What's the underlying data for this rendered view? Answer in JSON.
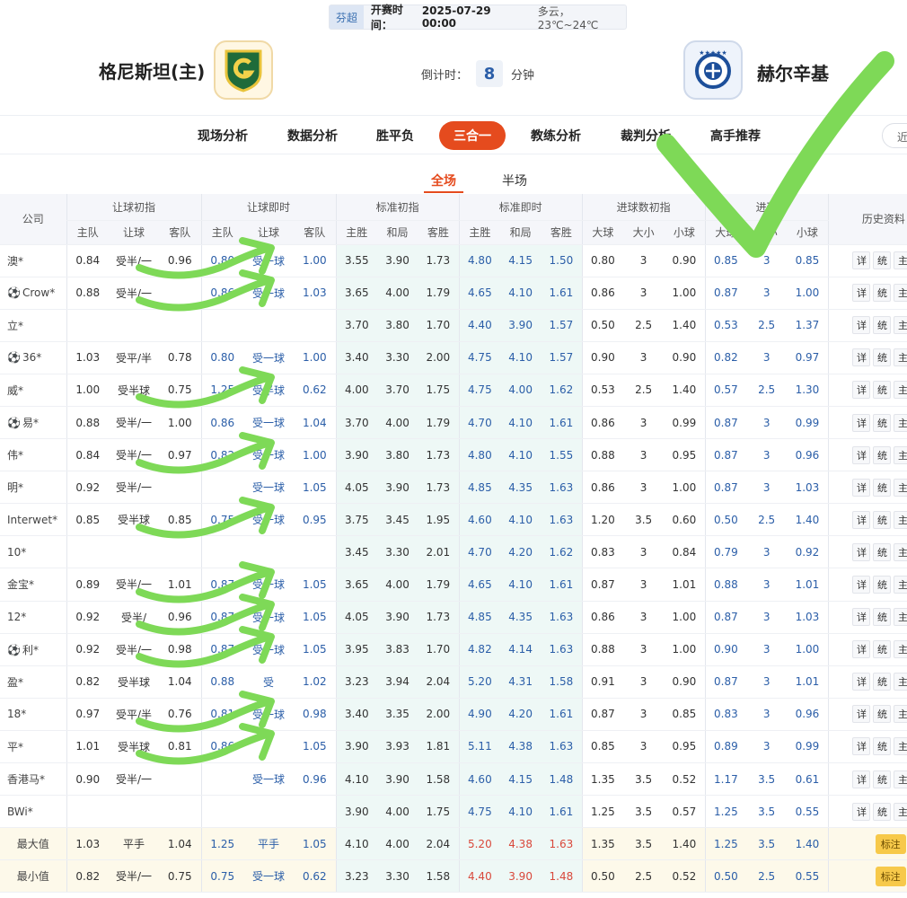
{
  "header": {
    "league": "芬超",
    "kickoff_label": "开赛时间：",
    "kickoff_time": "2025-07-29 00:00",
    "weather": "多云，23℃~24℃",
    "home_team": "格尼斯坦(主)",
    "away_team": "赫尔辛基",
    "countdown_label": "倒计时：",
    "countdown_value": "8",
    "countdown_unit": "分钟",
    "home_logo_icon": "gnistan-shield-logo-icon",
    "away_logo_icon": "hjk-crest-logo-icon"
  },
  "nav": {
    "tabs": [
      "现场分析",
      "数据分析",
      "胜平负",
      "三合一",
      "教练分析",
      "裁判分析",
      "高手推荐"
    ],
    "active_tab": "三合一",
    "recent": "近"
  },
  "scope": {
    "tabs": [
      "全场",
      "半场"
    ],
    "active": "全场"
  },
  "table": {
    "company_header": "公司",
    "groups": [
      "让球初指",
      "让球即时",
      "标准初指",
      "标准即时",
      "进球数初指",
      "进球数即时",
      "历史资料"
    ],
    "group_6_visible": "进球",
    "subheaders": {
      "handicap": [
        "主队",
        "让球",
        "客队"
      ],
      "standard": [
        "主胜",
        "和局",
        "客胜"
      ],
      "totals": [
        "大球",
        "大小",
        "小球"
      ]
    },
    "actions": [
      "详",
      "统",
      "主"
    ],
    "rows": [
      {
        "company": "澳*",
        "icon": "",
        "hi": [
          "0.84",
          "受半/一",
          "0.96"
        ],
        "hn": [
          "0.80",
          "受一球",
          "1.00"
        ],
        "si": [
          "3.55",
          "3.90",
          "1.73"
        ],
        "sn": [
          "4.80",
          "4.15",
          "1.50"
        ],
        "ti": [
          "0.80",
          "3",
          "0.90"
        ],
        "tn": [
          "0.85",
          "3",
          "0.85"
        ]
      },
      {
        "company": "Crow*",
        "icon": "soccer-ball-icon",
        "hi": [
          "0.88",
          "受半/一",
          ""
        ],
        "hn": [
          "0.86",
          "受一球",
          "1.03"
        ],
        "si": [
          "3.65",
          "4.00",
          "1.79"
        ],
        "sn": [
          "4.65",
          "4.10",
          "1.61"
        ],
        "ti": [
          "0.86",
          "3",
          "1.00"
        ],
        "tn": [
          "0.87",
          "3",
          "1.00"
        ]
      },
      {
        "company": "立*",
        "icon": "",
        "hi": [
          "",
          "",
          ""
        ],
        "hn": [
          "",
          "",
          ""
        ],
        "si": [
          "3.70",
          "3.80",
          "1.70"
        ],
        "sn": [
          "4.40",
          "3.90",
          "1.57"
        ],
        "ti": [
          "0.50",
          "2.5",
          "1.40"
        ],
        "tn": [
          "0.53",
          "2.5",
          "1.37"
        ]
      },
      {
        "company": "36*",
        "icon": "soccer-ball-icon",
        "hi": [
          "1.03",
          "受平/半",
          "0.78"
        ],
        "hn": [
          "0.80",
          "受一球",
          "1.00"
        ],
        "si": [
          "3.40",
          "3.30",
          "2.00"
        ],
        "sn": [
          "4.75",
          "4.10",
          "1.57"
        ],
        "ti": [
          "0.90",
          "3",
          "0.90"
        ],
        "tn": [
          "0.82",
          "3",
          "0.97"
        ]
      },
      {
        "company": "威*",
        "icon": "",
        "hi": [
          "1.00",
          "受半球",
          "0.75"
        ],
        "hn": [
          "1.25",
          "受半球",
          "0.62"
        ],
        "si": [
          "4.00",
          "3.70",
          "1.75"
        ],
        "sn": [
          "4.75",
          "4.00",
          "1.62"
        ],
        "ti": [
          "0.53",
          "2.5",
          "1.40"
        ],
        "tn": [
          "0.57",
          "2.5",
          "1.30"
        ]
      },
      {
        "company": "易*",
        "icon": "soccer-ball-icon",
        "hi": [
          "0.88",
          "受半/一",
          "1.00"
        ],
        "hn": [
          "0.86",
          "受一球",
          "1.04"
        ],
        "si": [
          "3.70",
          "4.00",
          "1.79"
        ],
        "sn": [
          "4.70",
          "4.10",
          "1.61"
        ],
        "ti": [
          "0.86",
          "3",
          "0.99"
        ],
        "tn": [
          "0.87",
          "3",
          "0.99"
        ]
      },
      {
        "company": "伟*",
        "icon": "",
        "hi": [
          "0.84",
          "受半/一",
          "0.97"
        ],
        "hn": [
          "0.82",
          "受一球",
          "1.00"
        ],
        "si": [
          "3.90",
          "3.80",
          "1.73"
        ],
        "sn": [
          "4.80",
          "4.10",
          "1.55"
        ],
        "ti": [
          "0.88",
          "3",
          "0.95"
        ],
        "tn": [
          "0.87",
          "3",
          "0.96"
        ]
      },
      {
        "company": "明*",
        "icon": "",
        "hi": [
          "0.92",
          "受半/一",
          ""
        ],
        "hn": [
          "",
          "受一球",
          "1.05"
        ],
        "si": [
          "4.05",
          "3.90",
          "1.73"
        ],
        "sn": [
          "4.85",
          "4.35",
          "1.63"
        ],
        "ti": [
          "0.86",
          "3",
          "1.00"
        ],
        "tn": [
          "0.87",
          "3",
          "1.03"
        ]
      },
      {
        "company": "Interwet*",
        "icon": "",
        "hi": [
          "0.85",
          "受半球",
          "0.85"
        ],
        "hn": [
          "0.75",
          "受一球",
          "0.95"
        ],
        "si": [
          "3.75",
          "3.45",
          "1.95"
        ],
        "sn": [
          "4.60",
          "4.10",
          "1.63"
        ],
        "ti": [
          "1.20",
          "3.5",
          "0.60"
        ],
        "tn": [
          "0.50",
          "2.5",
          "1.40"
        ]
      },
      {
        "company": "10*",
        "icon": "",
        "hi": [
          "",
          "",
          ""
        ],
        "hn": [
          "",
          "",
          ""
        ],
        "si": [
          "3.45",
          "3.30",
          "2.01"
        ],
        "sn": [
          "4.70",
          "4.20",
          "1.62"
        ],
        "ti": [
          "0.83",
          "3",
          "0.84"
        ],
        "tn": [
          "0.79",
          "3",
          "0.92"
        ]
      },
      {
        "company": "金宝*",
        "icon": "",
        "hi": [
          "0.89",
          "受半/一",
          "1.01"
        ],
        "hn": [
          "0.87",
          "受一球",
          "1.05"
        ],
        "si": [
          "3.65",
          "4.00",
          "1.79"
        ],
        "sn": [
          "4.65",
          "4.10",
          "1.61"
        ],
        "ti": [
          "0.87",
          "3",
          "1.01"
        ],
        "tn": [
          "0.88",
          "3",
          "1.01"
        ]
      },
      {
        "company": "12*",
        "icon": "",
        "hi": [
          "0.92",
          "受半/",
          "0.96"
        ],
        "hn": [
          "0.87",
          "受一球",
          "1.05"
        ],
        "si": [
          "4.05",
          "3.90",
          "1.73"
        ],
        "sn": [
          "4.85",
          "4.35",
          "1.63"
        ],
        "ti": [
          "0.86",
          "3",
          "1.00"
        ],
        "tn": [
          "0.87",
          "3",
          "1.03"
        ]
      },
      {
        "company": "利*",
        "icon": "soccer-ball-icon",
        "hi": [
          "0.92",
          "受半/一",
          "0.98"
        ],
        "hn": [
          "0.87",
          "受一球",
          "1.05"
        ],
        "si": [
          "3.95",
          "3.83",
          "1.70"
        ],
        "sn": [
          "4.82",
          "4.14",
          "1.63"
        ],
        "ti": [
          "0.88",
          "3",
          "1.00"
        ],
        "tn": [
          "0.90",
          "3",
          "1.00"
        ]
      },
      {
        "company": "盈*",
        "icon": "",
        "hi": [
          "0.82",
          "受半球",
          "1.04"
        ],
        "hn": [
          "0.88",
          "受",
          "1.02"
        ],
        "si": [
          "3.23",
          "3.94",
          "2.04"
        ],
        "sn": [
          "5.20",
          "4.31",
          "1.58"
        ],
        "ti": [
          "0.91",
          "3",
          "0.90"
        ],
        "tn": [
          "0.87",
          "3",
          "1.01"
        ]
      },
      {
        "company": "18*",
        "icon": "",
        "hi": [
          "0.97",
          "受平/半",
          "0.76"
        ],
        "hn": [
          "0.81",
          "受一球",
          "0.98"
        ],
        "si": [
          "3.40",
          "3.35",
          "2.00"
        ],
        "sn": [
          "4.90",
          "4.20",
          "1.61"
        ],
        "ti": [
          "0.87",
          "3",
          "0.85"
        ],
        "tn": [
          "0.83",
          "3",
          "0.96"
        ]
      },
      {
        "company": "平*",
        "icon": "",
        "hi": [
          "1.01",
          "受半球",
          "0.81"
        ],
        "hn": [
          "0.86",
          "",
          "1.05"
        ],
        "si": [
          "3.90",
          "3.93",
          "1.81"
        ],
        "sn": [
          "5.11",
          "4.38",
          "1.63"
        ],
        "ti": [
          "0.85",
          "3",
          "0.95"
        ],
        "tn": [
          "0.89",
          "3",
          "0.99"
        ]
      },
      {
        "company": "香港马*",
        "icon": "",
        "hi": [
          "0.90",
          "受半/一",
          ""
        ],
        "hn": [
          "",
          "受一球",
          "0.96"
        ],
        "si": [
          "4.10",
          "3.90",
          "1.58"
        ],
        "sn": [
          "4.60",
          "4.15",
          "1.48"
        ],
        "ti": [
          "1.35",
          "3.5",
          "0.52"
        ],
        "tn": [
          "1.17",
          "3.5",
          "0.61"
        ]
      },
      {
        "company": "BWi*",
        "icon": "",
        "hi": [
          "",
          "",
          ""
        ],
        "hn": [
          "",
          "",
          ""
        ],
        "si": [
          "3.90",
          "4.00",
          "1.75"
        ],
        "sn": [
          "4.75",
          "4.10",
          "1.61"
        ],
        "ti": [
          "1.25",
          "3.5",
          "0.57"
        ],
        "tn": [
          "1.25",
          "3.5",
          "0.55"
        ]
      }
    ],
    "max_row": {
      "label": "最大值",
      "hi": [
        "1.03",
        "平手",
        "1.04"
      ],
      "hn": [
        "1.25",
        "平手",
        "1.05"
      ],
      "si": [
        "4.10",
        "4.00",
        "2.04"
      ],
      "sn": [
        "5.20",
        "4.38",
        "1.63"
      ],
      "ti": [
        "1.35",
        "3.5",
        "1.40"
      ],
      "tn": [
        "1.25",
        "3.5",
        "1.40"
      ],
      "mark": "标注"
    },
    "min_row": {
      "label": "最小值",
      "hi": [
        "0.82",
        "受半/一",
        "0.75"
      ],
      "hn": [
        "0.75",
        "受一球",
        "0.62"
      ],
      "si": [
        "3.23",
        "3.30",
        "1.58"
      ],
      "sn": [
        "4.40",
        "3.90",
        "1.48"
      ],
      "ti": [
        "0.50",
        "2.5",
        "0.52"
      ],
      "tn": [
        "0.50",
        "2.5",
        "0.55"
      ],
      "mark": "标注"
    }
  },
  "annotation": {
    "stroke_color": "#7ed957",
    "arrow_rows": [
      0,
      1,
      4,
      6,
      8,
      10,
      11,
      12,
      14,
      15
    ],
    "checkmark": true
  }
}
